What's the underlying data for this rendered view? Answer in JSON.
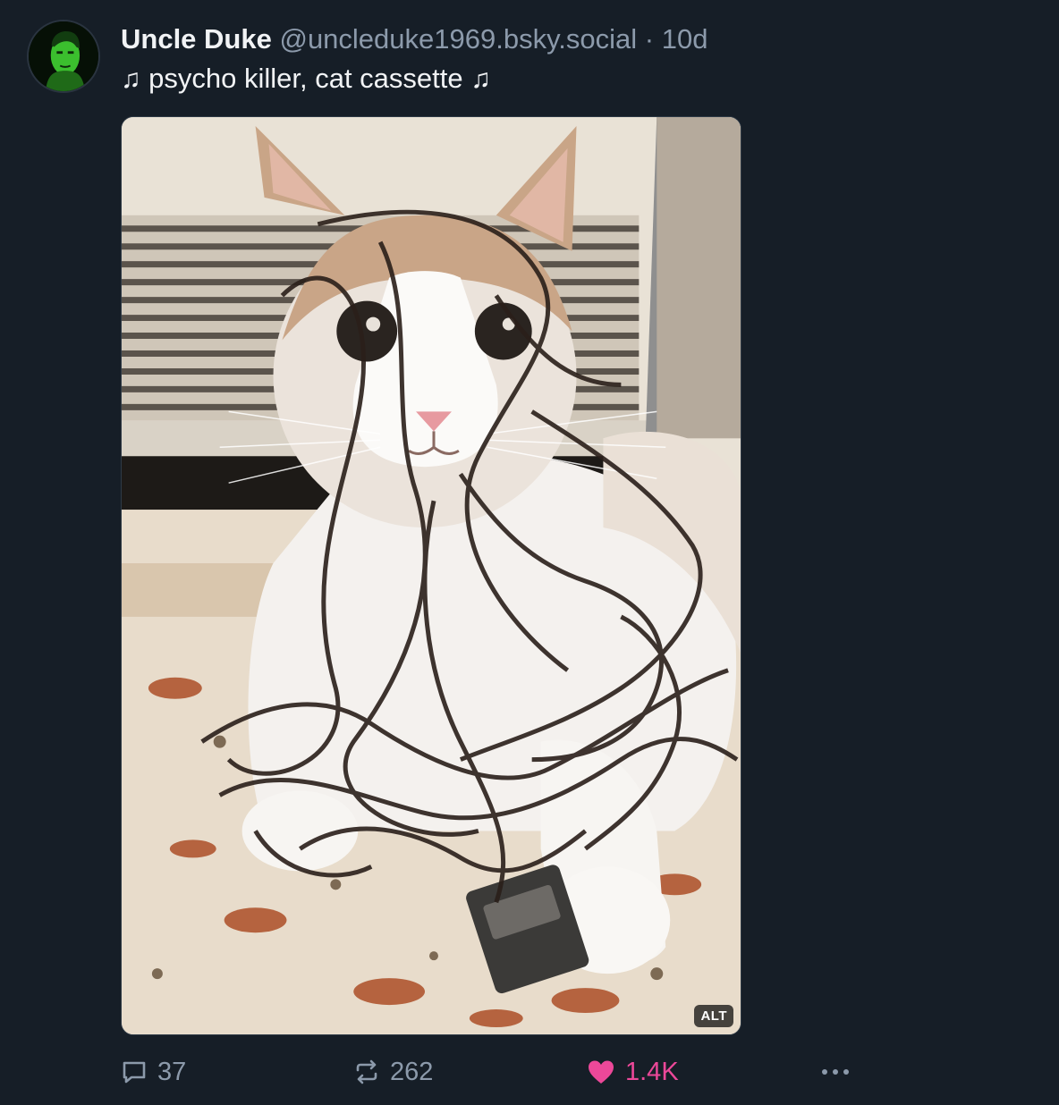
{
  "post": {
    "author_name": "Uncle Duke",
    "author_handle": "@uncleduke1969.bsky.social",
    "separator": "·",
    "time": "10d",
    "text": "psycho killer, cat cassette",
    "note_glyph": "♫"
  },
  "media": {
    "alt_badge": "ALT"
  },
  "actions": {
    "replies": "37",
    "reposts": "262",
    "likes": "1.4K"
  },
  "colors": {
    "background": "#161e27",
    "muted": "#8c9aab",
    "like": "#ec4899"
  },
  "icons": [
    "reply-icon",
    "repost-icon",
    "heart-icon",
    "more-icon",
    "music-note-icon"
  ]
}
